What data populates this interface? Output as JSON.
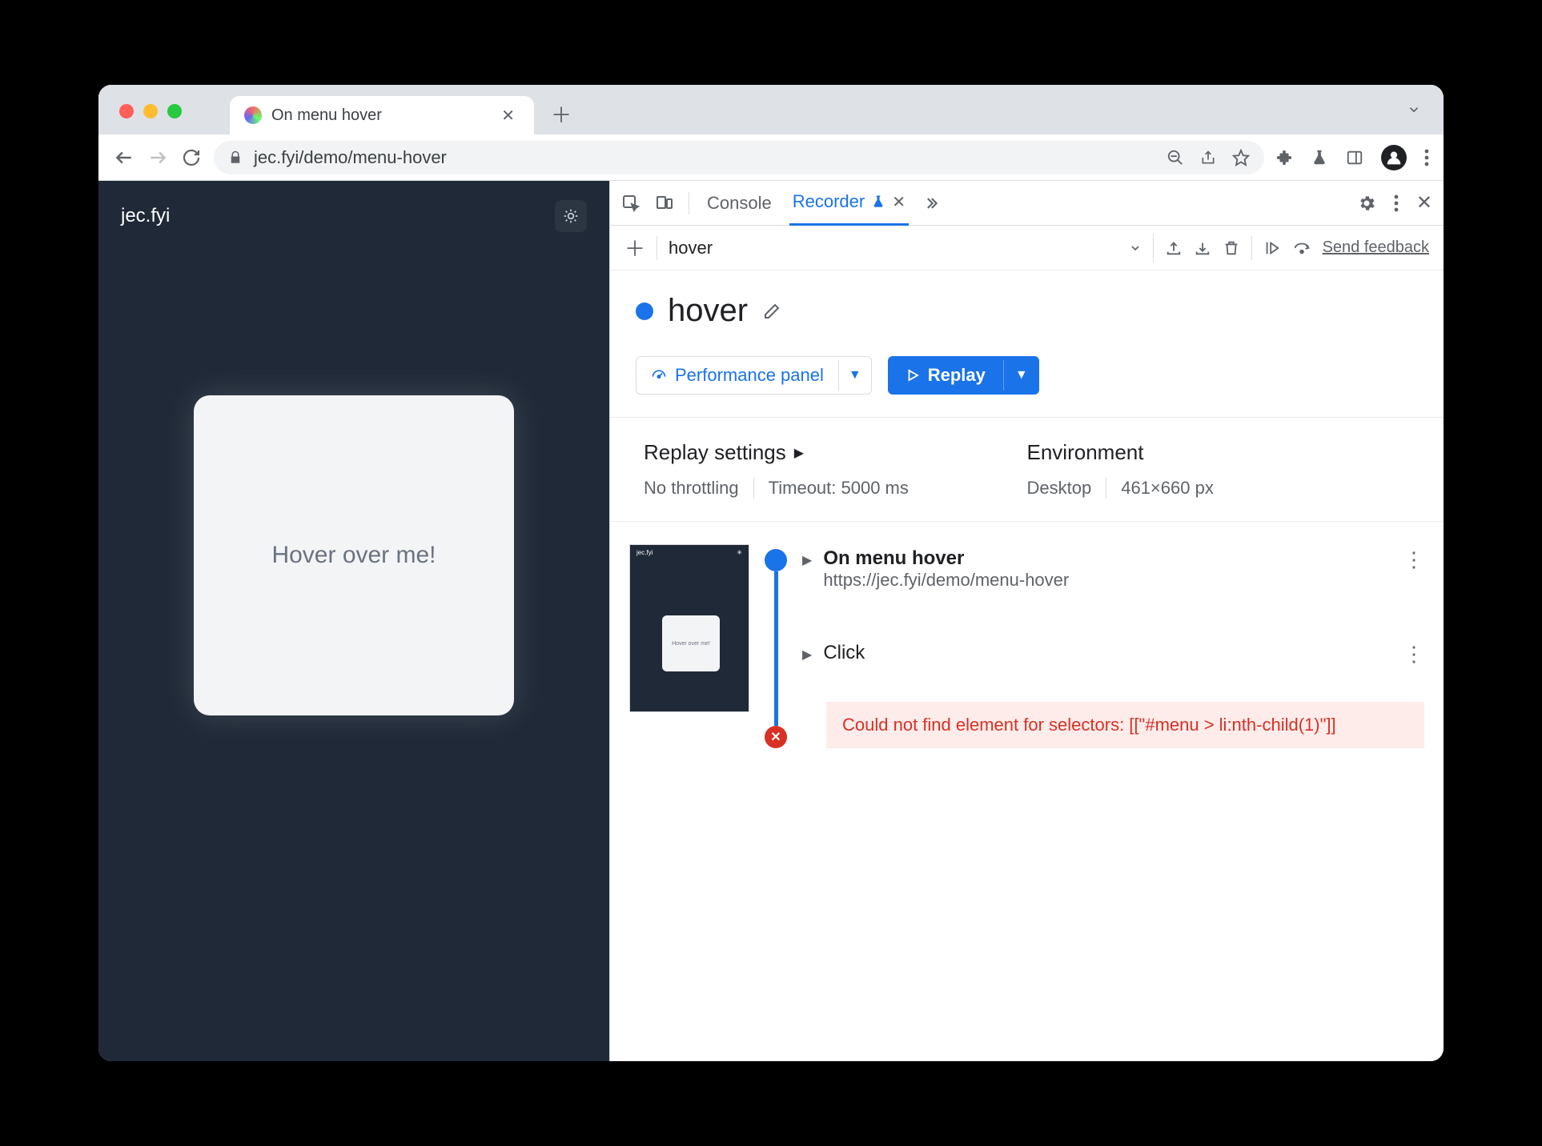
{
  "tab": {
    "title": "On menu hover"
  },
  "url": "jec.fyi/demo/menu-hover",
  "page": {
    "logo": "jec.fyi",
    "hover_card": "Hover over me!"
  },
  "devtools": {
    "tabs": {
      "console": "Console",
      "recorder": "Recorder"
    },
    "bar2": {
      "recording_name": "hover",
      "send_feedback": "Send feedback"
    },
    "recording": {
      "title": "hover"
    },
    "buttons": {
      "perf": "Performance panel",
      "replay": "Replay"
    },
    "settings": {
      "replay_label": "Replay settings",
      "throttling": "No throttling",
      "timeout": "Timeout: 5000 ms",
      "env_label": "Environment",
      "device": "Desktop",
      "viewport": "461×660 px"
    },
    "thumb": {
      "logo": "jec.fyi",
      "card": "Hover over me!"
    },
    "steps": {
      "s1_title": "On menu hover",
      "s1_url": "https://jec.fyi/demo/menu-hover",
      "s2_title": "Click",
      "error": "Could not find element for selectors: [[\"#menu > li:nth-child(1)\"]]"
    }
  }
}
